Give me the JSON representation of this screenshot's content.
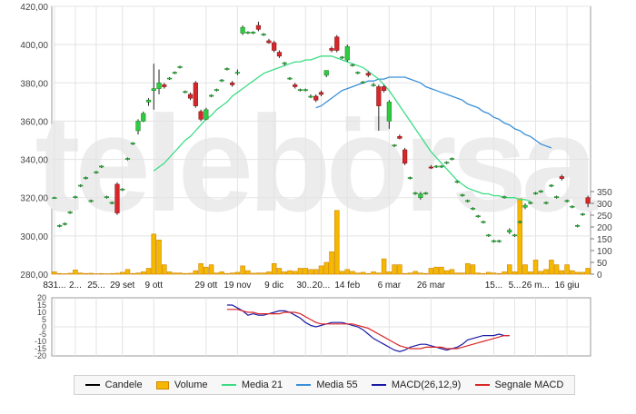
{
  "chart_data": [
    {
      "type": "candlestick",
      "title": "",
      "ylim": [
        280,
        420
      ],
      "y_ticks": [
        280,
        300,
        320,
        340,
        360,
        380,
        400,
        420
      ],
      "volume_ylim": [
        0,
        350
      ],
      "volume_ticks": [
        0,
        50,
        100,
        150,
        200,
        250,
        300,
        350
      ],
      "x_labels": [
        "831...",
        "2...",
        "25...",
        "29 set",
        "9 ott",
        "29 ott",
        "19 nov",
        "9 dic",
        "30...",
        "20...",
        "14 feb",
        "6 mar",
        "26 mar",
        "15...",
        "5...",
        "26 m...",
        "16 giu"
      ],
      "x_label_index": [
        0,
        4,
        8,
        13,
        19,
        29,
        35,
        42,
        48,
        51,
        56,
        64,
        72,
        84,
        88,
        92,
        98
      ],
      "candles": [
        [
          320,
          320.5,
          319.5,
          320
        ],
        [
          305,
          306,
          304.5,
          305.5
        ],
        [
          306,
          307,
          305.5,
          306.5
        ],
        [
          312,
          313,
          311.5,
          312.5
        ],
        [
          320,
          321,
          319.5,
          320.5
        ],
        [
          326,
          327,
          325.5,
          326.5
        ],
        [
          330,
          331,
          329.5,
          330.5
        ],
        [
          318,
          319,
          317.5,
          318.5
        ],
        [
          333,
          334,
          332.5,
          333.5
        ],
        [
          336,
          337,
          335.5,
          336.5
        ],
        [
          320,
          321,
          319.5,
          320.5
        ],
        [
          317,
          318,
          316.5,
          317.5
        ],
        [
          327,
          328,
          311,
          312
        ],
        [
          324,
          325,
          323.5,
          324.5
        ],
        [
          340,
          341,
          339.5,
          340.5
        ],
        [
          348,
          349,
          347.5,
          348.5
        ],
        [
          355,
          361,
          353,
          360
        ],
        [
          360,
          365,
          359.5,
          364
        ],
        [
          370,
          372,
          368,
          371
        ],
        [
          376,
          390,
          366,
          377
        ],
        [
          377,
          387,
          374,
          380
        ],
        [
          379,
          380,
          377,
          378
        ],
        [
          382,
          383,
          381.5,
          382.5
        ],
        [
          385,
          386,
          384.5,
          385.5
        ],
        [
          388,
          389,
          387.5,
          388.5
        ],
        [
          375,
          376,
          374.5,
          375.5
        ],
        [
          374,
          375,
          371,
          372
        ],
        [
          380,
          381,
          367,
          368
        ],
        [
          365,
          366,
          360,
          361
        ],
        [
          361,
          367,
          360.5,
          366
        ],
        [
          373,
          374,
          372.5,
          373.5
        ],
        [
          376,
          377,
          375.5,
          376.5
        ],
        [
          381,
          382,
          380.5,
          381.5
        ],
        [
          387,
          388,
          386.5,
          387.5
        ],
        [
          380,
          381,
          378,
          379
        ],
        [
          385,
          387,
          384,
          385.5
        ],
        [
          406,
          410,
          405,
          409
        ],
        [
          406,
          407,
          405.5,
          406.5
        ],
        [
          406,
          407,
          405.5,
          406.5
        ],
        [
          410,
          412,
          407,
          408
        ],
        [
          405,
          406,
          404.5,
          405.5
        ],
        [
          402,
          403,
          400.5,
          401
        ],
        [
          401,
          402,
          396,
          397
        ],
        [
          396,
          397,
          393,
          394
        ],
        [
          390,
          391,
          389,
          390.5
        ],
        [
          382,
          383,
          381.5,
          382.5
        ],
        [
          379,
          380,
          377,
          378
        ],
        [
          376,
          377,
          375.5,
          376.5
        ],
        [
          376,
          377,
          375.5,
          376.5
        ],
        [
          373,
          374,
          372,
          373
        ],
        [
          373,
          374,
          370,
          371
        ],
        [
          375,
          376,
          373,
          374
        ],
        [
          384,
          385,
          383,
          386.5
        ],
        [
          398,
          399,
          396,
          397
        ],
        [
          404,
          405,
          396,
          397
        ],
        [
          393,
          394,
          392.5,
          393.5
        ],
        [
          392,
          400,
          391,
          399
        ],
        [
          389,
          390,
          388.5,
          389.5
        ],
        [
          385,
          386,
          384.5,
          385.5
        ],
        [
          380,
          381,
          379.5,
          380.5
        ],
        [
          385,
          386,
          383,
          384
        ],
        [
          379,
          380,
          378,
          379
        ],
        [
          378,
          379,
          355,
          368
        ],
        [
          378,
          379,
          375,
          376
        ],
        [
          360,
          371,
          356,
          370
        ],
        [
          347,
          348,
          346.5,
          347.5
        ],
        [
          352,
          353,
          350.5,
          351
        ],
        [
          345,
          346,
          337,
          338
        ],
        [
          330,
          331,
          329.5,
          330.5
        ],
        [
          322,
          323,
          321.5,
          322.5
        ],
        [
          320,
          323,
          319,
          322
        ],
        [
          322,
          323,
          321.5,
          322.5
        ],
        [
          336,
          337,
          335,
          335.5
        ],
        [
          336,
          337,
          335.5,
          336.5
        ],
        [
          336,
          337,
          335.5,
          336.5
        ],
        [
          338,
          339,
          337.5,
          338.5
        ],
        [
          340,
          341,
          339.5,
          340.5
        ],
        [
          328,
          329,
          327.5,
          328.5
        ],
        [
          321,
          322,
          320.5,
          321.5
        ],
        [
          318,
          319,
          317.5,
          318.5
        ],
        [
          314,
          315,
          313.5,
          314.5
        ],
        [
          310,
          311,
          309.5,
          310.5
        ],
        [
          307,
          308,
          306.5,
          307.5
        ],
        [
          300,
          301,
          299.5,
          300.5
        ],
        [
          297,
          298,
          296.5,
          297.5
        ],
        [
          297,
          298,
          296.5,
          297.5
        ],
        [
          320,
          321,
          319.5,
          320.5
        ],
        [
          302,
          304,
          301,
          303
        ],
        [
          300,
          301,
          299.5,
          300.5
        ],
        [
          307,
          308,
          306.5,
          307.5
        ],
        [
          315,
          317,
          314,
          316
        ],
        [
          317,
          318,
          316.5,
          317.5
        ],
        [
          322,
          323,
          321.5,
          322.5
        ],
        [
          323,
          324,
          322.5,
          323.5
        ],
        [
          317,
          318,
          316.5,
          317.5
        ],
        [
          326,
          327,
          325.5,
          326.5
        ],
        [
          320,
          321,
          319.5,
          320.5
        ],
        [
          331,
          332,
          329,
          330
        ],
        [
          318,
          319,
          317.5,
          318.5
        ],
        [
          315,
          316,
          314.5,
          315.5
        ],
        [
          305,
          306,
          304.5,
          305.5
        ],
        [
          311,
          312,
          310.5,
          311.5
        ],
        [
          320,
          321,
          315,
          317
        ]
      ],
      "volumes": [
        10,
        3,
        2,
        4,
        18,
        5,
        3,
        4,
        2,
        3,
        2,
        3,
        4,
        8,
        20,
        3,
        5,
        10,
        25,
        170,
        145,
        40,
        10,
        5,
        5,
        3,
        4,
        15,
        45,
        30,
        40,
        5,
        10,
        3,
        5,
        8,
        35,
        15,
        4,
        5,
        5,
        10,
        45,
        25,
        10,
        15,
        12,
        25,
        25,
        20,
        20,
        35,
        50,
        95,
        270,
        12,
        20,
        12,
        5,
        8,
        3,
        10,
        5,
        65,
        10,
        40,
        40,
        3,
        5,
        12,
        5,
        3,
        25,
        30,
        30,
        15,
        20,
        5,
        5,
        45,
        40,
        5,
        3,
        8,
        5,
        3,
        10,
        40,
        10,
        320,
        40,
        10,
        60,
        12,
        20,
        60,
        40,
        15,
        40,
        15,
        8,
        8,
        25
      ]
    },
    {
      "type": "line",
      "ylim": [
        -20,
        20
      ],
      "y_ticks": [
        -20,
        -15,
        -10,
        -5,
        0,
        5,
        10,
        15,
        20
      ],
      "series": [
        {
          "name": "MACD(26,12,9)",
          "start": 33,
          "values": [
            15,
            15,
            13,
            11,
            8,
            9,
            8,
            8,
            9,
            10,
            11,
            11,
            10,
            8,
            6,
            3,
            1,
            0,
            1,
            2,
            3,
            3,
            3,
            2,
            1,
            0,
            -2,
            -5,
            -8,
            -10,
            -12,
            -14,
            -16,
            -17,
            -16,
            -14,
            -13,
            -12,
            -12,
            -13,
            -14,
            -15,
            -16,
            -15,
            -14,
            -12,
            -9,
            -8,
            -7,
            -6,
            -6,
            -6,
            -5,
            -6,
            -6
          ]
        },
        {
          "name": "Segnale MACD",
          "start": 33,
          "values": [
            12,
            12,
            12,
            11,
            10,
            10,
            9,
            9,
            9,
            9,
            9,
            10,
            10,
            10,
            9,
            7,
            5,
            3,
            2,
            2,
            2,
            2,
            2,
            2,
            2,
            1,
            0,
            -1,
            -3,
            -5,
            -7,
            -9,
            -11,
            -13,
            -14,
            -15,
            -15,
            -15,
            -14,
            -14,
            -14,
            -14,
            -15,
            -15,
            -15,
            -14,
            -13,
            -12,
            -11,
            -10,
            -9,
            -8,
            -7,
            -6,
            -6
          ]
        }
      ]
    }
  ],
  "ma21": {
    "start": 19,
    "values": [
      334,
      336,
      338,
      341,
      344,
      347,
      350,
      352,
      355,
      358,
      361,
      363,
      366,
      368,
      370,
      373,
      375,
      377,
      379,
      381,
      383,
      385,
      386,
      387,
      388,
      389,
      390,
      391,
      391,
      392,
      392,
      393,
      394,
      394,
      394,
      393,
      392,
      391,
      390,
      389,
      388,
      386,
      384,
      382,
      379,
      376,
      372,
      368,
      364,
      360,
      356,
      352,
      348,
      344,
      341,
      338,
      335,
      332,
      329,
      327,
      325,
      324,
      323,
      322,
      322,
      321,
      321,
      320,
      320,
      320,
      319,
      319,
      318
    ]
  },
  "ma55": {
    "start": 50,
    "values": [
      367,
      368,
      370,
      372,
      374,
      376,
      377,
      378,
      379,
      380,
      381,
      381,
      382,
      382,
      383,
      383,
      383,
      383,
      382,
      381,
      380,
      378,
      377,
      376,
      375,
      374,
      373,
      372,
      371,
      369,
      368,
      367,
      365,
      364,
      362,
      361,
      359,
      358,
      356,
      355,
      353,
      352,
      350,
      348,
      347,
      346
    ]
  },
  "watermark": "telebörsa",
  "legend": [
    {
      "label": "Candele",
      "color": "#000000",
      "kind": "line"
    },
    {
      "label": "Volume",
      "color": "#f5b800",
      "kind": "box"
    },
    {
      "label": "Media 21",
      "color": "#3ddc84",
      "kind": "line"
    },
    {
      "label": "Media 55",
      "color": "#3a8fd9",
      "kind": "line"
    },
    {
      "label": "MACD(26,12,9)",
      "color": "#1a1aa6",
      "kind": "line"
    },
    {
      "label": "Segnale MACD",
      "color": "#d92626",
      "kind": "line"
    }
  ]
}
